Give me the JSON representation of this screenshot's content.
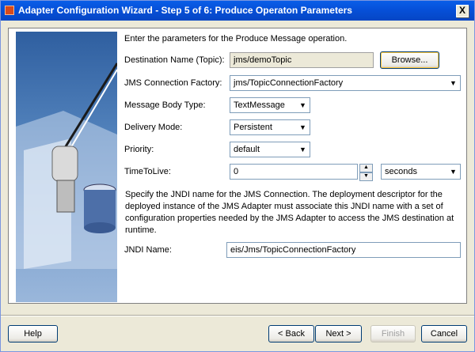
{
  "window": {
    "title": "Adapter Configuration Wizard - Step 5 of 6: Produce Operaton Parameters",
    "close_label": "X"
  },
  "intro": "Enter the parameters for the Produce Message operation.",
  "form": {
    "destination": {
      "label": "Destination Name (Topic):",
      "value": "jms/demoTopic",
      "browse_label": "Browse..."
    },
    "connection_factory": {
      "label": "JMS Connection Factory:",
      "value": "jms/TopicConnectionFactory"
    },
    "message_body_type": {
      "label": "Message Body Type:",
      "value": "TextMessage"
    },
    "delivery_mode": {
      "label": "Delivery Mode:",
      "value": "Persistent"
    },
    "priority": {
      "label": "Priority:",
      "value": "default"
    },
    "time_to_live": {
      "label": "TimeToLive:",
      "value": "0",
      "unit": "seconds"
    }
  },
  "jndi": {
    "description_lines": [
      "Specify the JNDI name for the JMS Connection.  The deployment descriptor for the",
      "deployed instance of the JMS Adapter must associate this JNDI name with a set of",
      "configuration properties needed by the JMS Adapter to access the JMS destination at",
      "runtime."
    ],
    "label": "JNDI Name:",
    "value": "eis/Jms/TopicConnectionFactory"
  },
  "buttons": {
    "help": "Help",
    "back": "< Back",
    "next": "Next >",
    "finish": "Finish",
    "cancel": "Cancel"
  },
  "colors": {
    "titlebar": "#0650d9",
    "dialog_bg": "#ece9d8"
  },
  "icons": {
    "window": "app-icon",
    "close": "close-icon",
    "dropdown": "chevron-down-icon",
    "side": "plug-database-illustration"
  }
}
